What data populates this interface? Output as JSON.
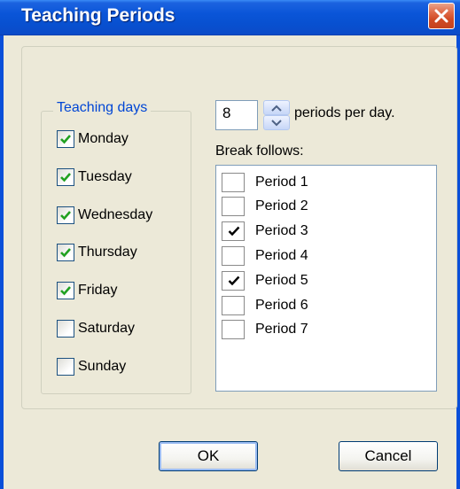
{
  "window": {
    "title": "Teaching Periods"
  },
  "teaching_days": {
    "legend": "Teaching days",
    "days": [
      {
        "label": "Monday",
        "checked": true
      },
      {
        "label": "Tuesday",
        "checked": true
      },
      {
        "label": "Wednesday",
        "checked": true
      },
      {
        "label": "Thursday",
        "checked": true
      },
      {
        "label": "Friday",
        "checked": true
      },
      {
        "label": "Saturday",
        "checked": false
      },
      {
        "label": "Sunday",
        "checked": false
      }
    ]
  },
  "periods": {
    "value": "8",
    "suffix_label": "periods per day."
  },
  "break_follows": {
    "label": "Break follows:",
    "items": [
      {
        "label": "Period 1",
        "checked": false
      },
      {
        "label": "Period 2",
        "checked": false
      },
      {
        "label": "Period 3",
        "checked": true
      },
      {
        "label": "Period 4",
        "checked": false
      },
      {
        "label": "Period 5",
        "checked": true
      },
      {
        "label": "Period 6",
        "checked": false
      },
      {
        "label": "Period 7",
        "checked": false
      }
    ]
  },
  "buttons": {
    "ok": "OK",
    "cancel": "Cancel"
  },
  "colors": {
    "title_bar": "#0a55d8",
    "dialog_bg": "#ece9d8",
    "group_legend": "#0046d5",
    "checkmark": "#21a121",
    "close_button": "#d04a24"
  },
  "icons": {
    "close": "close-icon",
    "spin_up": "arrow-up-icon",
    "spin_down": "arrow-down-icon"
  }
}
